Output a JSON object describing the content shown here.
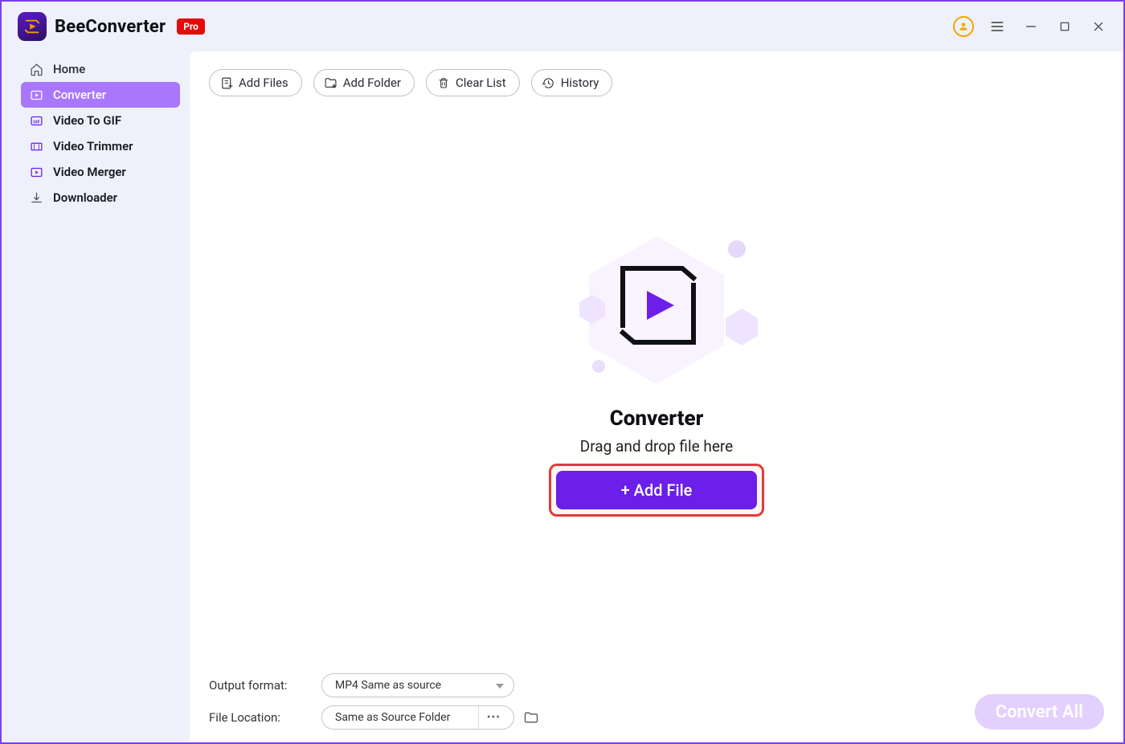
{
  "header": {
    "app_name": "BeeConverter",
    "badge": "Pro"
  },
  "sidebar": {
    "items": [
      {
        "label": "Home"
      },
      {
        "label": "Converter"
      },
      {
        "label": "Video To GIF"
      },
      {
        "label": "Video Trimmer"
      },
      {
        "label": "Video Merger"
      },
      {
        "label": "Downloader"
      }
    ]
  },
  "toolbar": {
    "add_files": "Add Files",
    "add_folder": "Add Folder",
    "clear_list": "Clear List",
    "history": "History"
  },
  "empty_state": {
    "title": "Converter",
    "subtitle": "Drag and drop file here",
    "button": "+ Add File"
  },
  "footer": {
    "output_label": "Output format:",
    "output_value": "MP4 Same as source",
    "file_location_label": "File Location:",
    "file_location_value": "Same as Source Folder",
    "convert_all": "Convert All"
  }
}
